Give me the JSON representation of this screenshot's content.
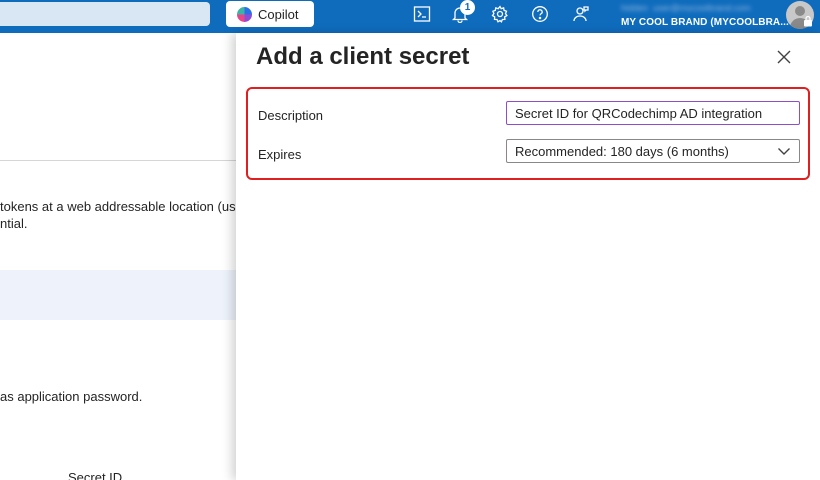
{
  "topbar": {
    "copilot_label": "Copilot",
    "notification_count": "1",
    "user_email": "hidden_user@mycoolbrand.com",
    "tenant_name": "MY COOL BRAND (MYCOOLBRA...",
    "icons": [
      "cloud-shell-icon",
      "bell-icon",
      "gear-icon",
      "help-icon",
      "feedback-icon"
    ]
  },
  "background": {
    "line1": "tokens at a web addressable location (usi",
    "line2": "ntial.",
    "line3": "as application password.",
    "column_header": "Secret ID"
  },
  "panel": {
    "title": "Add a client secret",
    "description_label": "Description",
    "description_value": "Secret ID for QRCodechimp AD integration",
    "expires_label": "Expires",
    "expires_value": "Recommended: 180 days (6 months)"
  },
  "colors": {
    "topbar": "#0f6cbd",
    "highlight_border": "#e02020",
    "input_focus_border": "#8e4ec6"
  }
}
